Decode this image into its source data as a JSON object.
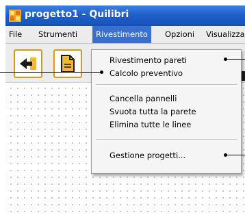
{
  "window": {
    "title": "progetto1 - Quilibri"
  },
  "menubar": {
    "items": [
      {
        "label": "File"
      },
      {
        "label": "Strumenti"
      },
      {
        "label": "Rivestimento"
      },
      {
        "label": "Opzioni"
      },
      {
        "label": "Visualizza"
      }
    ]
  },
  "rivestimento_menu": {
    "items": [
      {
        "label": "Rivestimento pareti"
      },
      {
        "label": "Calcolo preventivo"
      },
      {
        "label": "Cancella pannelli"
      },
      {
        "label": "Svuota tutta la parete"
      },
      {
        "label": "Elimina tutte le linee"
      },
      {
        "label": "Gestione progetti..."
      }
    ]
  },
  "colors": {
    "titlebar": "#1f5fc9",
    "menu_highlight": "#3a6fd0",
    "toolbar_button_border": "#d99a18",
    "arrow_fill": "#1a1a1a",
    "doc_fill": "#f2b63a"
  },
  "icons": [
    "app-icon",
    "back-arrow-icon",
    "document-icon"
  ]
}
